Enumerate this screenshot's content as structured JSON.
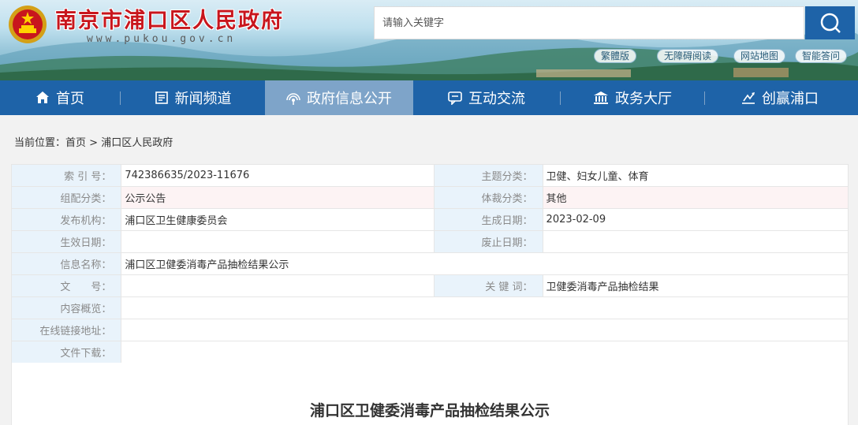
{
  "header": {
    "site_title": "南京市浦口区人民政府",
    "site_url": "www.pukou.gov.cn",
    "search": {
      "placeholder": "请输入关键字"
    },
    "quick_links": [
      "繁體版",
      "无障碍阅读",
      "网站地图",
      "智能答问"
    ]
  },
  "nav": {
    "items": [
      {
        "label": "首页",
        "icon": "home-icon"
      },
      {
        "label": "新闻频道",
        "icon": "news-icon"
      },
      {
        "label": "政府信息公开",
        "icon": "broadcast-icon",
        "active": true
      },
      {
        "label": "互动交流",
        "icon": "chat-icon"
      },
      {
        "label": "政务大厅",
        "icon": "hall-icon"
      },
      {
        "label": "创赢浦口",
        "icon": "growth-icon"
      }
    ]
  },
  "breadcrumb": {
    "prefix": "当前位置：",
    "home": "首页",
    "sep": " > ",
    "current": "浦口区人民政府"
  },
  "meta": {
    "index_label": "索 引 号：",
    "index_value": "742386635/2023-11676",
    "topic_label": "主题分类：",
    "topic_value": "卫健、妇女儿童、体育",
    "group_label": "组配分类：",
    "group_value": "公示公告",
    "genre_label": "体裁分类：",
    "genre_value": "其他",
    "issuer_label": "发布机构：",
    "issuer_value": "浦口区卫生健康委员会",
    "date_label": "生成日期：",
    "date_value": "2023-02-09",
    "effective_label": "生效日期：",
    "effective_value": "",
    "expire_label": "废止日期：",
    "expire_value": "",
    "name_label": "信息名称：",
    "name_value": "浦口区卫健委消毒产品抽检结果公示",
    "docno_label": "文　　号：",
    "docno_value": "",
    "keywords_label": "关 键 词：",
    "keywords_value": "卫健委消毒产品抽检结果",
    "summary_label": "内容概览：",
    "summary_value": "",
    "link_label": "在线链接地址：",
    "link_value": "",
    "download_label": "文件下载：",
    "download_value": ""
  },
  "article": {
    "title": "浦口区卫健委消毒产品抽检结果公示"
  },
  "colors": {
    "nav_blue": "#1e63a8",
    "nav_active": "#7ea4c9",
    "title_red": "#c8161d",
    "label_bg": "#e9f3fb"
  }
}
